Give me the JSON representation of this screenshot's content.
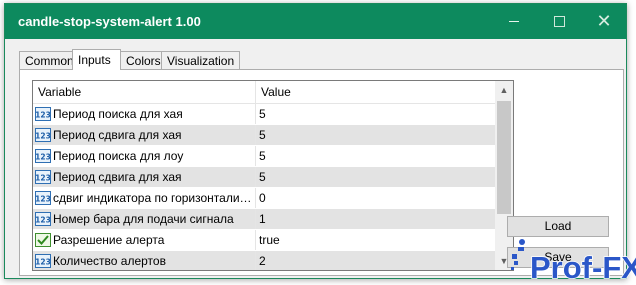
{
  "window": {
    "title": "candle-stop-system-alert 1.00"
  },
  "tabs": [
    {
      "label": "Common"
    },
    {
      "label": "Inputs"
    },
    {
      "label": "Colors"
    },
    {
      "label": "Visualization"
    }
  ],
  "grid": {
    "headers": {
      "variable": "Variable",
      "value": "Value"
    },
    "rows": [
      {
        "icon": "numeric-123-icon",
        "name": "Период поиска для хая",
        "value": "5"
      },
      {
        "icon": "numeric-123-icon",
        "name": "Период сдвига для хая",
        "value": "5"
      },
      {
        "icon": "numeric-123-icon",
        "name": "Период поиска для лоу",
        "value": "5"
      },
      {
        "icon": "numeric-123-icon",
        "name": "Период сдвига для хая",
        "value": "5"
      },
      {
        "icon": "numeric-123-icon",
        "name": "сдвиг индикатора по горизонтали в...",
        "value": "0"
      },
      {
        "icon": "numeric-123-icon",
        "name": "Номер бара для подачи сигнала",
        "value": "1"
      },
      {
        "icon": "boolean-icon",
        "name": "Разрешение алерта",
        "value": "true"
      },
      {
        "icon": "numeric-123-icon",
        "name": "Количество алертов",
        "value": "2"
      }
    ]
  },
  "buttons": {
    "load": "Load",
    "save": "Save"
  },
  "watermark": {
    "text": "Prof-FX"
  },
  "colors": {
    "titlebar": "#0d8a5e",
    "watermark": "#2b57c8"
  }
}
